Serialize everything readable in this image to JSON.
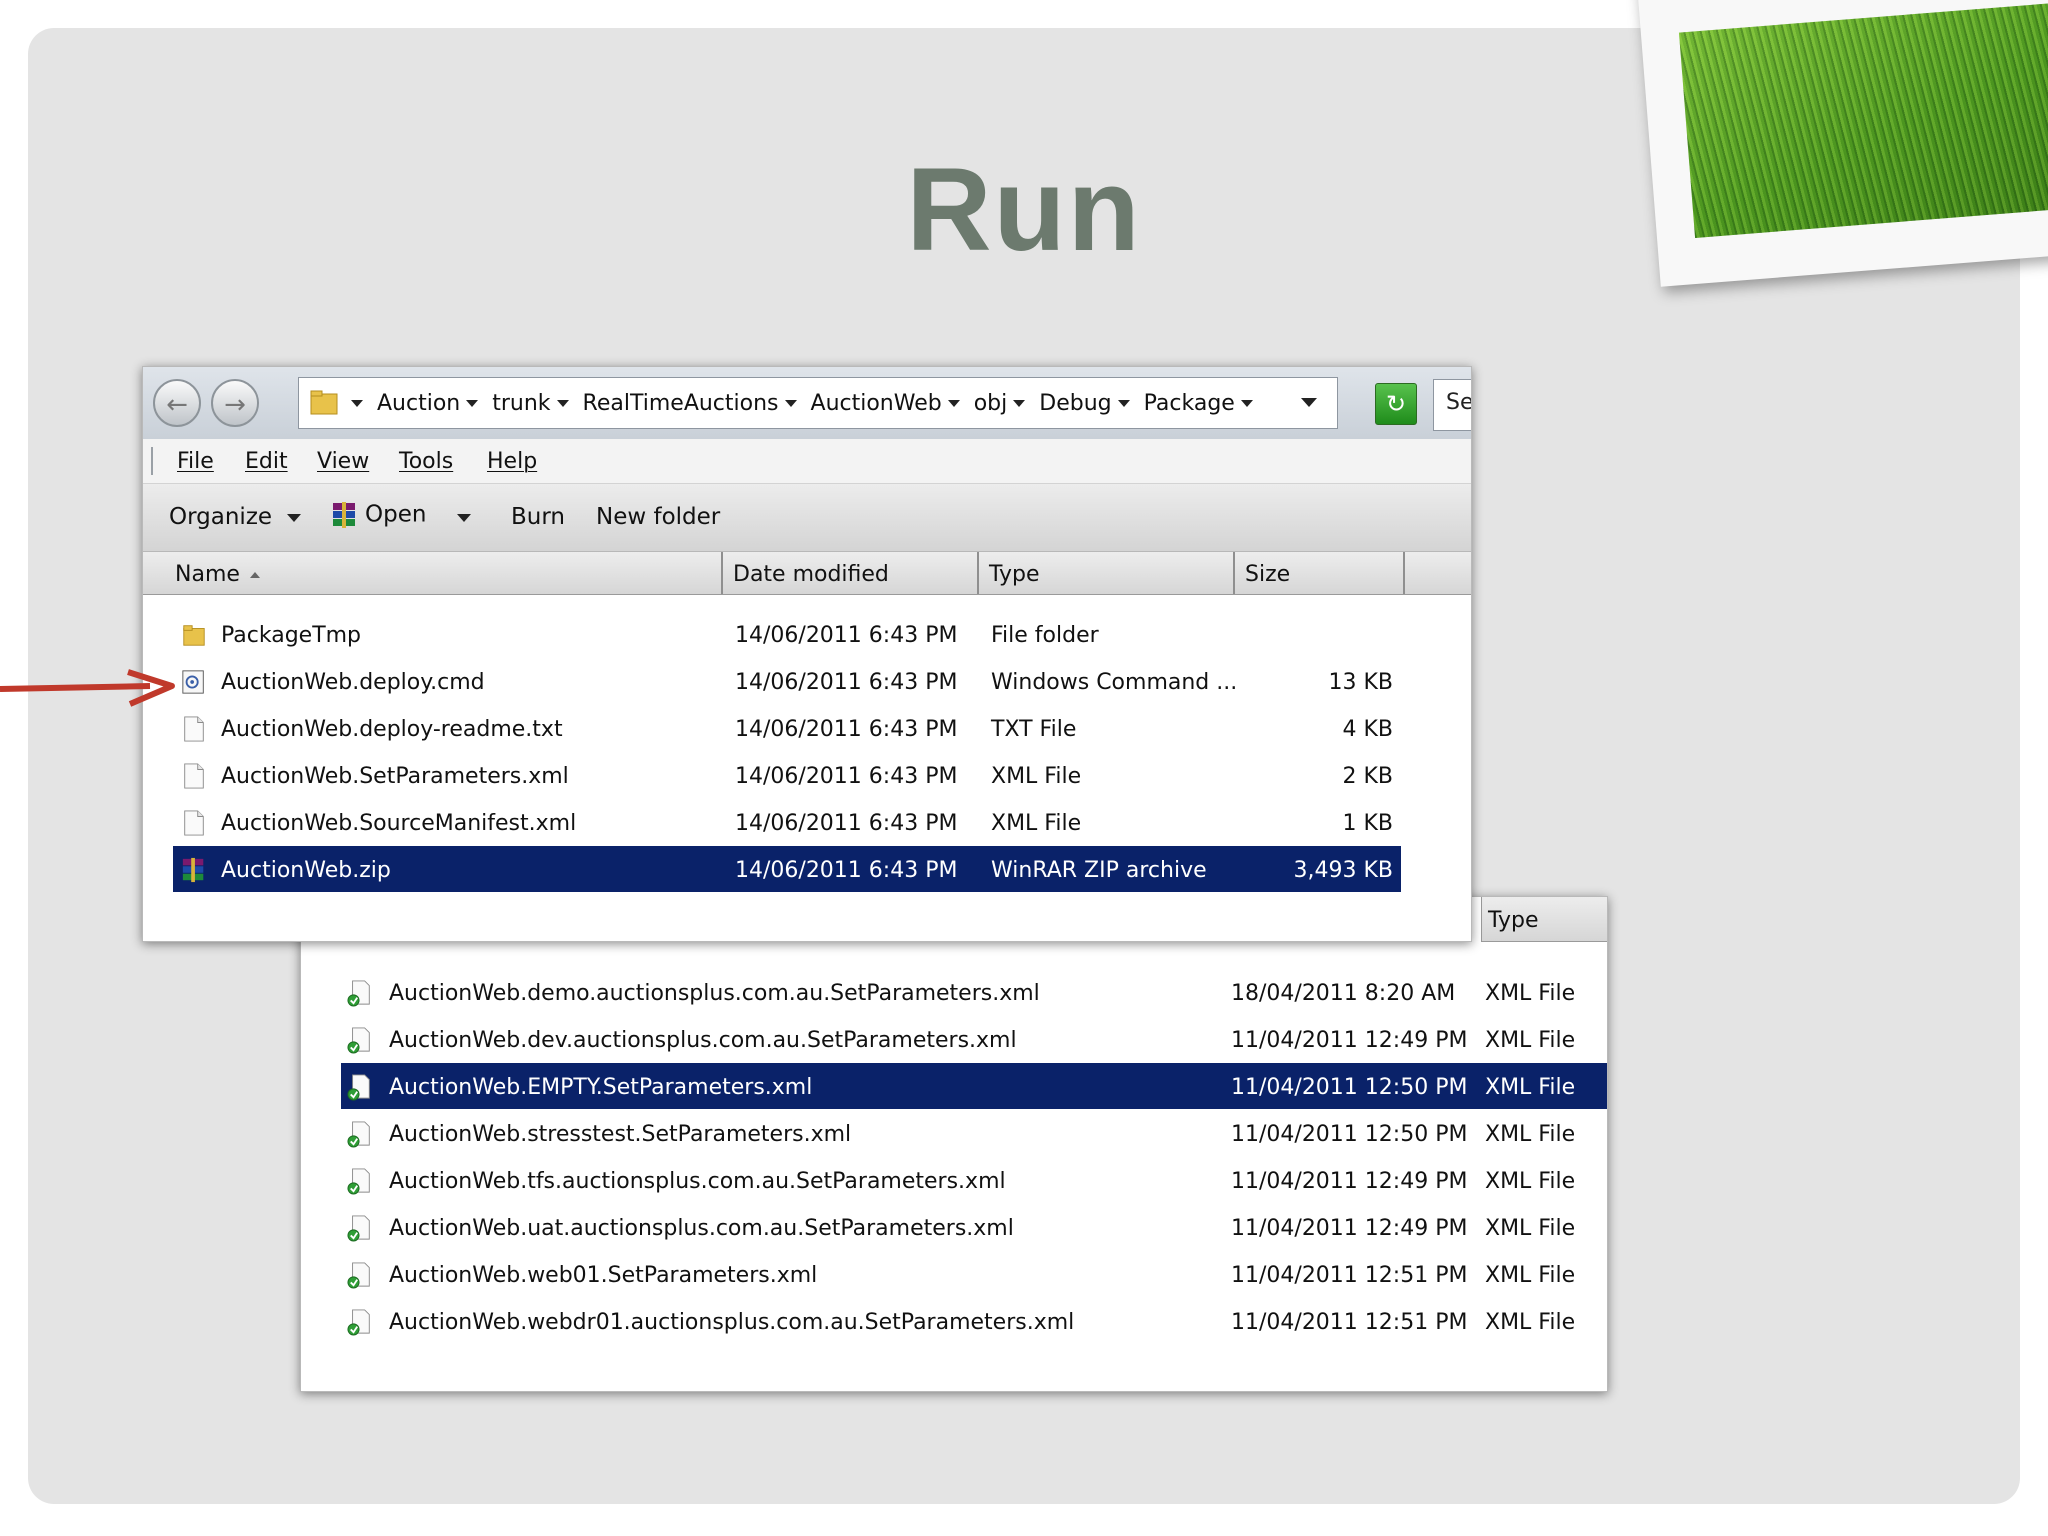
{
  "slide": {
    "title": "Run"
  },
  "explorer": {
    "breadcrumbs": [
      "Auction",
      "trunk",
      "RealTimeAuctions",
      "AuctionWeb",
      "obj",
      "Debug",
      "Package"
    ],
    "search_partial": "Se",
    "menu": [
      "File",
      "Edit",
      "View",
      "Tools",
      "Help"
    ],
    "toolbar": {
      "organize": "Organize",
      "open": "Open",
      "burn": "Burn",
      "new_folder": "New folder"
    },
    "columns": {
      "name": "Name",
      "date": "Date modified",
      "type": "Type",
      "size": "Size"
    },
    "files": [
      {
        "name": "PackageTmp",
        "date": "14/06/2011 6:43 PM",
        "type": "File folder",
        "size": "",
        "icon": "folder-icon"
      },
      {
        "name": "AuctionWeb.deploy.cmd",
        "date": "14/06/2011 6:43 PM",
        "type": "Windows Command ...",
        "size": "13 KB",
        "icon": "cmd-file-icon"
      },
      {
        "name": "AuctionWeb.deploy-readme.txt",
        "date": "14/06/2011 6:43 PM",
        "type": "TXT File",
        "size": "4 KB",
        "icon": "text-file-icon"
      },
      {
        "name": "AuctionWeb.SetParameters.xml",
        "date": "14/06/2011 6:43 PM",
        "type": "XML File",
        "size": "2 KB",
        "icon": "text-file-icon"
      },
      {
        "name": "AuctionWeb.SourceManifest.xml",
        "date": "14/06/2011 6:43 PM",
        "type": "XML File",
        "size": "1 KB",
        "icon": "text-file-icon"
      },
      {
        "name": "AuctionWeb.zip",
        "date": "14/06/2011 6:43 PM",
        "type": "WinRAR ZIP archive",
        "size": "3,493 KB",
        "icon": "winrar-icon",
        "selected": true
      }
    ]
  },
  "second_list": {
    "type_header": "Type",
    "files": [
      {
        "name": "AuctionWeb.demo.auctionsplus.com.au.SetParameters.xml",
        "date": "18/04/2011 8:20 AM",
        "type": "XML File"
      },
      {
        "name": "AuctionWeb.dev.auctionsplus.com.au.SetParameters.xml",
        "date": "11/04/2011 12:49 PM",
        "type": "XML File"
      },
      {
        "name": "AuctionWeb.EMPTY.SetParameters.xml",
        "date": "11/04/2011 12:50 PM",
        "type": "XML File",
        "selected": true
      },
      {
        "name": "AuctionWeb.stresstest.SetParameters.xml",
        "date": "11/04/2011 12:50 PM",
        "type": "XML File"
      },
      {
        "name": "AuctionWeb.tfs.auctionsplus.com.au.SetParameters.xml",
        "date": "11/04/2011 12:49 PM",
        "type": "XML File"
      },
      {
        "name": "AuctionWeb.uat.auctionsplus.com.au.SetParameters.xml",
        "date": "11/04/2011 12:49 PM",
        "type": "XML File"
      },
      {
        "name": "AuctionWeb.web01.SetParameters.xml",
        "date": "11/04/2011 12:51 PM",
        "type": "XML File"
      },
      {
        "name": "AuctionWeb.webdr01.auctionsplus.com.au.SetParameters.xml",
        "date": "11/04/2011 12:51 PM",
        "type": "XML File"
      }
    ]
  },
  "colors": {
    "selection": "#0a2269",
    "title": "#6c7a6e",
    "arrow": "#c0392b"
  }
}
